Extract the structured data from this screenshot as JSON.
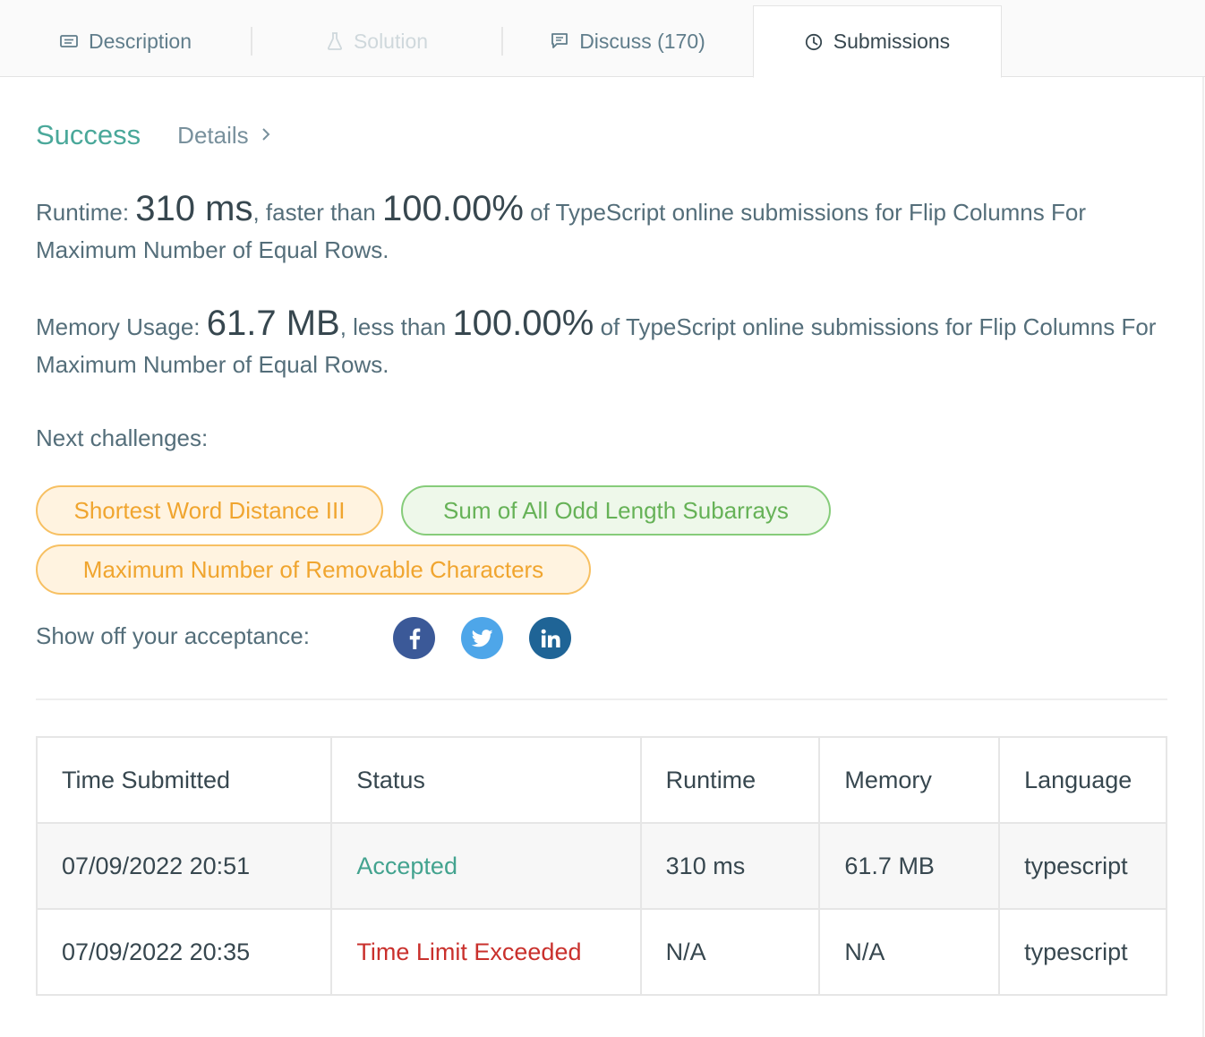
{
  "tabs": [
    {
      "label": "Description",
      "icon": "description-icon",
      "state": "normal"
    },
    {
      "label": "Solution",
      "icon": "flask-icon",
      "state": "disabled"
    },
    {
      "label": "Discuss (170)",
      "icon": "comment-icon",
      "state": "normal"
    },
    {
      "label": "Submissions",
      "icon": "clock-icon",
      "state": "active"
    }
  ],
  "result": {
    "status": "Success",
    "details_label": "Details",
    "status_color": "#4aa89a"
  },
  "runtime": {
    "label": "Runtime: ",
    "value": "310 ms",
    "compare_text": ", faster than ",
    "percent": "100.00%",
    "suffix": " of TypeScript online submissions for Flip Columns For Maximum Number of Equal Rows."
  },
  "memory": {
    "label": "Memory Usage: ",
    "value": "61.7 MB",
    "compare_text": ", less than ",
    "percent": "100.00%",
    "suffix": " of TypeScript online submissions for Flip Columns For Maximum Number of Equal Rows."
  },
  "next_challenges": {
    "label": "Next challenges:",
    "items": [
      {
        "label": "Shortest Word Distance III",
        "difficulty_color": "#f0a52f"
      },
      {
        "label": "Sum of All Odd Length Subarrays",
        "difficulty_color": "#66b257"
      },
      {
        "label": "Maximum Number of Removable Characters",
        "difficulty_color": "#f0a52f"
      }
    ]
  },
  "share": {
    "label": "Show off your acceptance:",
    "networks": [
      "facebook-icon",
      "twitter-icon",
      "linkedin-icon"
    ]
  },
  "submissions_table": {
    "headers": [
      "Time Submitted",
      "Status",
      "Runtime",
      "Memory",
      "Language"
    ],
    "rows": [
      {
        "time": "07/09/2022 20:51",
        "status": "Accepted",
        "runtime": "310 ms",
        "memory": "61.7 MB",
        "language": "typescript"
      },
      {
        "time": "07/09/2022 20:35",
        "status": "Time Limit Exceeded",
        "runtime": "N/A",
        "memory": "N/A",
        "language": "typescript"
      }
    ]
  },
  "colors": {
    "accepted": "#43a38f",
    "time_limit_exceeded": "#c9302c"
  }
}
